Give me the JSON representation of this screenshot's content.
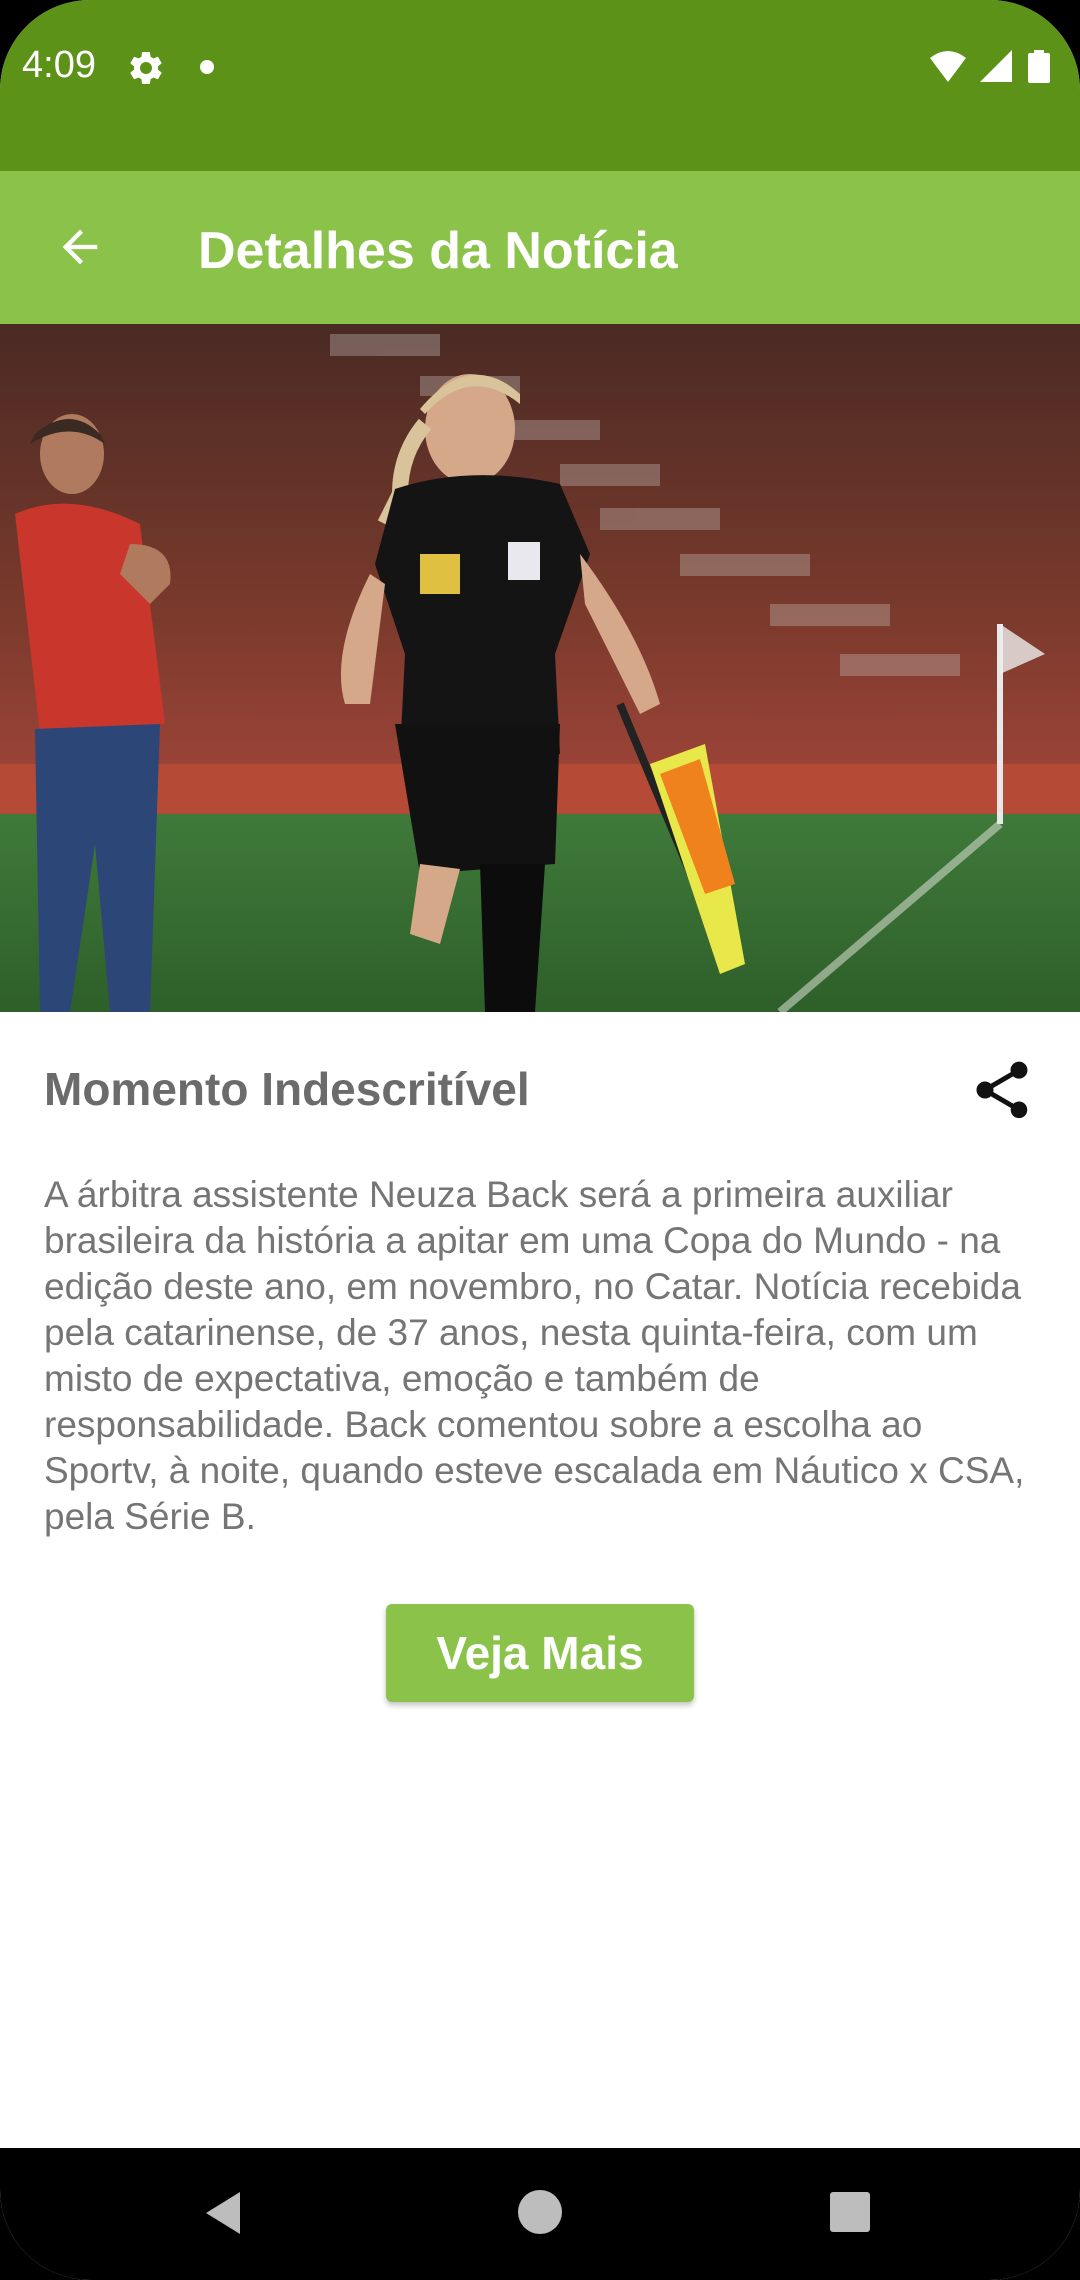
{
  "status_bar": {
    "time": "4:09",
    "icons": [
      "gear-icon",
      "notification-dot-icon",
      "wifi-icon",
      "signal-icon",
      "battery-icon"
    ],
    "color": "#5c9217"
  },
  "app_bar": {
    "title": "Detalhes da Notícia",
    "back_icon": "arrow-back-icon",
    "color": "#8bc34a"
  },
  "article": {
    "hero_image": "photo of assistant referee with flag on football field",
    "headline": "Momento Indescritível",
    "share_icon": "share-icon",
    "body": "A árbitra assistente Neuza Back será a primeira auxiliar brasileira da história a apitar em uma Copa do Mundo - na edição deste ano, em novembro, no Catar. Notícia recebida pela catarinense, de 37 anos, nesta quinta-feira, com um misto de expectativa, emoção e também de responsabilidade. Back comentou sobre a escolha ao Sportv, à noite, quando esteve escalada em Náutico x CSA, pela Série B.",
    "more_button_label": "Veja Mais"
  },
  "nav_bar": {
    "icons": [
      "nav-back-icon",
      "nav-home-icon",
      "nav-recents-icon"
    ]
  }
}
